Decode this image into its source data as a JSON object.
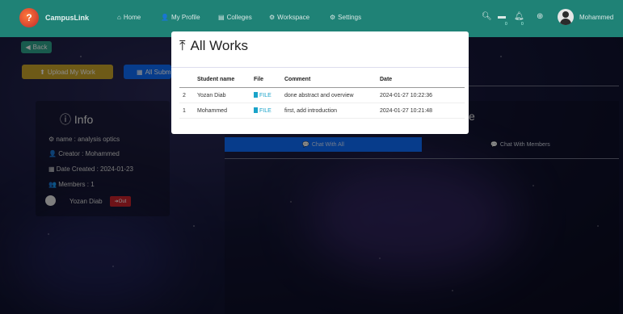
{
  "nav": {
    "brand": "CampusLink",
    "links": [
      {
        "label": "Home",
        "icon": "home-icon"
      },
      {
        "label": "My Profile",
        "icon": "user-icon"
      },
      {
        "label": "Colleges",
        "icon": "building-icon"
      },
      {
        "label": "Workspace",
        "icon": "sitemap-icon"
      },
      {
        "label": "Settings",
        "icon": "gears-icon"
      }
    ],
    "msg_badge": "0",
    "notif_badge": "0",
    "user": "Mohammed"
  },
  "page": {
    "back_label": "Back",
    "upload_label": "Upload My Work",
    "all_submissions_label": "All Submi",
    "info_title": "Info",
    "info_rows": [
      "name : analysis optics",
      "Creator : Mohammed",
      "Date Created : 2024-01-23",
      "Members : 1"
    ],
    "member_name": "Yozan Diab",
    "out_label": "Out",
    "chat_heading_fragment": "e",
    "chat_all_label": "Chat With All",
    "chat_members_label": "Chat With Members"
  },
  "modal": {
    "title": "All Works",
    "columns": [
      "",
      "Student name",
      "File",
      "Comment",
      "Date"
    ],
    "rows": [
      {
        "index": "2",
        "student": "Yozan Diab",
        "file": "FILE",
        "comment": "done abstract and overview",
        "date": "2024-01-27 10:22:36"
      },
      {
        "index": "1",
        "student": "Mohammed",
        "file": "FILE",
        "comment": "first, add introduction",
        "date": "2024-01-27 10:21:48"
      }
    ]
  },
  "colors": {
    "navbar": "#1f8276",
    "back_button": "#2fa58c",
    "upload_button": "#c9a52b",
    "primary_blue": "#0d6efd",
    "danger": "#c8232c",
    "file_link": "#1aa3c9"
  }
}
